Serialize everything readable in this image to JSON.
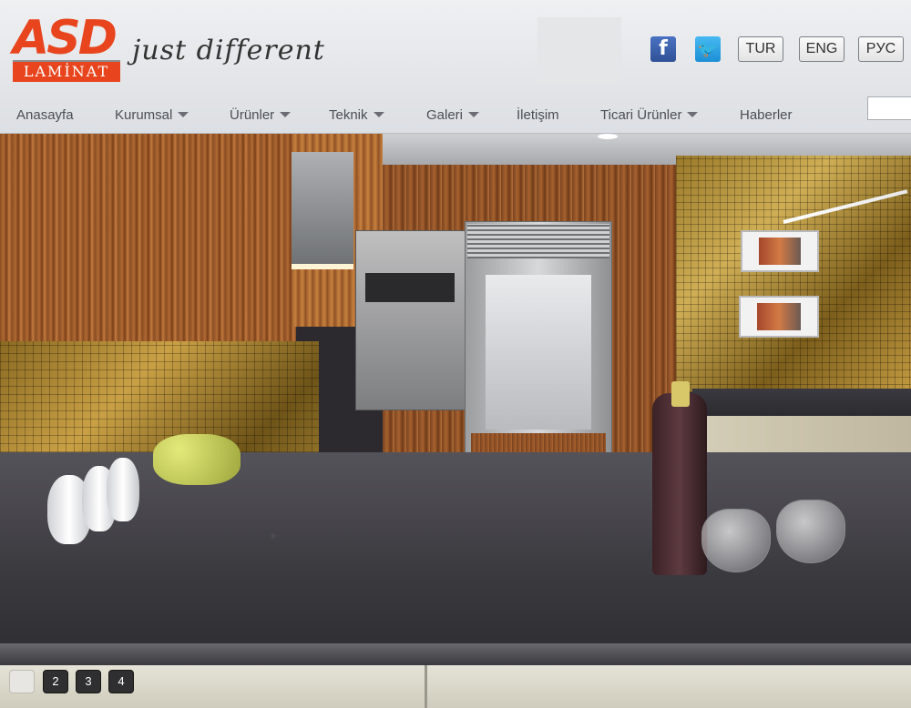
{
  "header": {
    "logo": {
      "main": "ASD",
      "sub": "LAMİNAT"
    },
    "tagline": "just different",
    "social": [
      {
        "name": "facebook-icon",
        "glyph": "f"
      },
      {
        "name": "twitter-icon",
        "glyph": "🐦"
      }
    ],
    "languages": [
      "TUR",
      "ENG",
      "PУC"
    ]
  },
  "nav": {
    "items": [
      {
        "label": "Anasayfa",
        "dropdown": false
      },
      {
        "label": "Kurumsal",
        "dropdown": true
      },
      {
        "label": "Ürünler",
        "dropdown": true
      },
      {
        "label": "Teknik",
        "dropdown": true
      },
      {
        "label": "Galeri",
        "dropdown": true
      },
      {
        "label": "İletişim",
        "dropdown": false
      },
      {
        "label": "Ticari Ürünler",
        "dropdown": true
      },
      {
        "label": "Haberler",
        "dropdown": false
      }
    ],
    "search_placeholder": ""
  },
  "slider": {
    "pages": [
      "1",
      "2",
      "3",
      "4"
    ],
    "active_page": 1
  },
  "colors": {
    "brand": "#e8451e",
    "header_bg": "#e4e6e9",
    "nav_text": "#4b4f55"
  }
}
